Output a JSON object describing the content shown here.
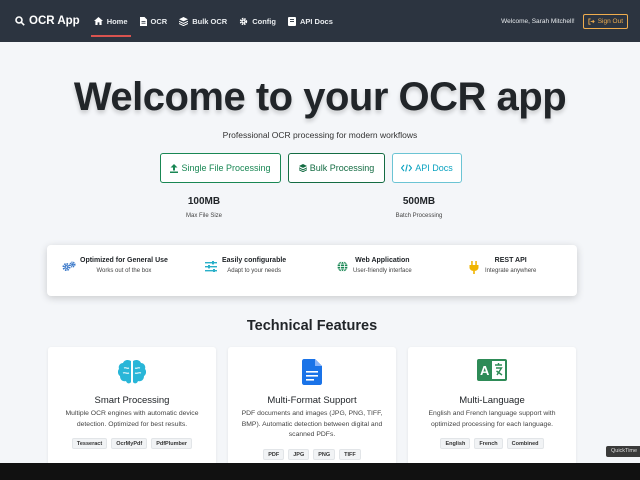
{
  "navbar": {
    "brand": "OCR App",
    "links": [
      {
        "label": "Home",
        "active": true
      },
      {
        "label": "OCR"
      },
      {
        "label": "Bulk OCR"
      },
      {
        "label": "Config"
      },
      {
        "label": "API Docs"
      }
    ],
    "welcome": "Welcome, Sarah Mitchell!",
    "signout": "Sign Out"
  },
  "hero": {
    "title": "Welcome to your OCR app",
    "subtitle": "Professional OCR processing for modern workflows",
    "buttons": [
      {
        "label": "Single File Processing"
      },
      {
        "label": "Bulk Processing"
      },
      {
        "label": "API Docs"
      }
    ],
    "stats": [
      {
        "value": "100MB",
        "label": "Max File Size"
      },
      {
        "value": "500MB",
        "label": "Batch Processing"
      }
    ]
  },
  "features": [
    {
      "title": "Optimized for General Use",
      "desc": "Works out of the box",
      "icon": "gears-icon"
    },
    {
      "title": "Easily configurable",
      "desc": "Adapt to your needs",
      "icon": "sliders-icon"
    },
    {
      "title": "Web Application",
      "desc": "User-friendly interface",
      "icon": "globe-icon"
    },
    {
      "title": "REST API",
      "desc": "Integrate anywhere",
      "icon": "plug-icon"
    }
  ],
  "technical": {
    "title": "Technical Features",
    "cards": [
      {
        "title": "Smart Processing",
        "desc": "Multiple OCR engines with automatic device detection. Optimized for best results.",
        "tags": [
          "Tesseract",
          "OcrMyPdf",
          "PdfPlumber"
        ],
        "icon": "brain-icon"
      },
      {
        "title": "Multi-Format Support",
        "desc": "PDF documents and images (JPG, PNG, TIFF, BMP). Automatic detection between digital and scanned PDFs.",
        "tags": [
          "PDF",
          "JPG",
          "PNG",
          "TIFF"
        ],
        "icon": "document-icon"
      },
      {
        "title": "Multi-Language",
        "desc": "English and French language support with optimized processing for each language.",
        "tags": [
          "English",
          "French",
          "Combined"
        ],
        "icon": "translate-icon"
      }
    ]
  },
  "overlay": {
    "quicktime": "QuickTime"
  },
  "colors": {
    "navbar": "#2c3440",
    "accent_green": "#198754",
    "accent_cyan": "#0aa2c0",
    "signout": "#f0ad4e",
    "active_underline": "#d9534f"
  }
}
